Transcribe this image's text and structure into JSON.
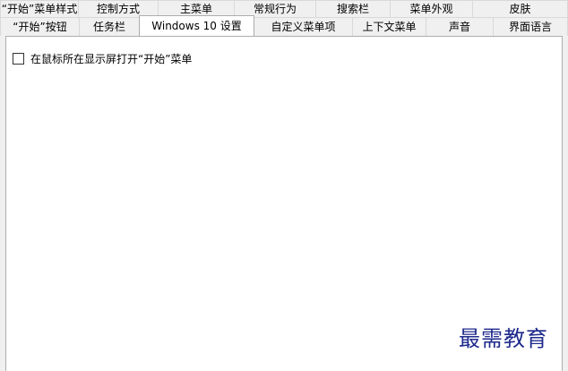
{
  "tabs_row1": [
    {
      "label": "“开始”菜单样式"
    },
    {
      "label": "控制方式"
    },
    {
      "label": "主菜单"
    },
    {
      "label": "常规行为"
    },
    {
      "label": "搜索栏"
    },
    {
      "label": "菜单外观"
    },
    {
      "label": "皮肤"
    }
  ],
  "tabs_row2": [
    {
      "label": "“开始”按钮"
    },
    {
      "label": "任务栏"
    },
    {
      "label": "Windows 10 设置",
      "active": true
    },
    {
      "label": "自定义菜单项"
    },
    {
      "label": "上下文菜单"
    },
    {
      "label": "声音"
    },
    {
      "label": "界面语言"
    }
  ],
  "panel": {
    "option": {
      "label": "在鼠标所在显示屏打开“开始”菜单",
      "checked": false
    }
  },
  "watermark": {
    "text": "最需教育",
    "color": "#1e2a8c"
  },
  "colors": {
    "window_bg": "#f0f0f0",
    "panel_bg": "#ffffff",
    "border": "#adadad"
  }
}
